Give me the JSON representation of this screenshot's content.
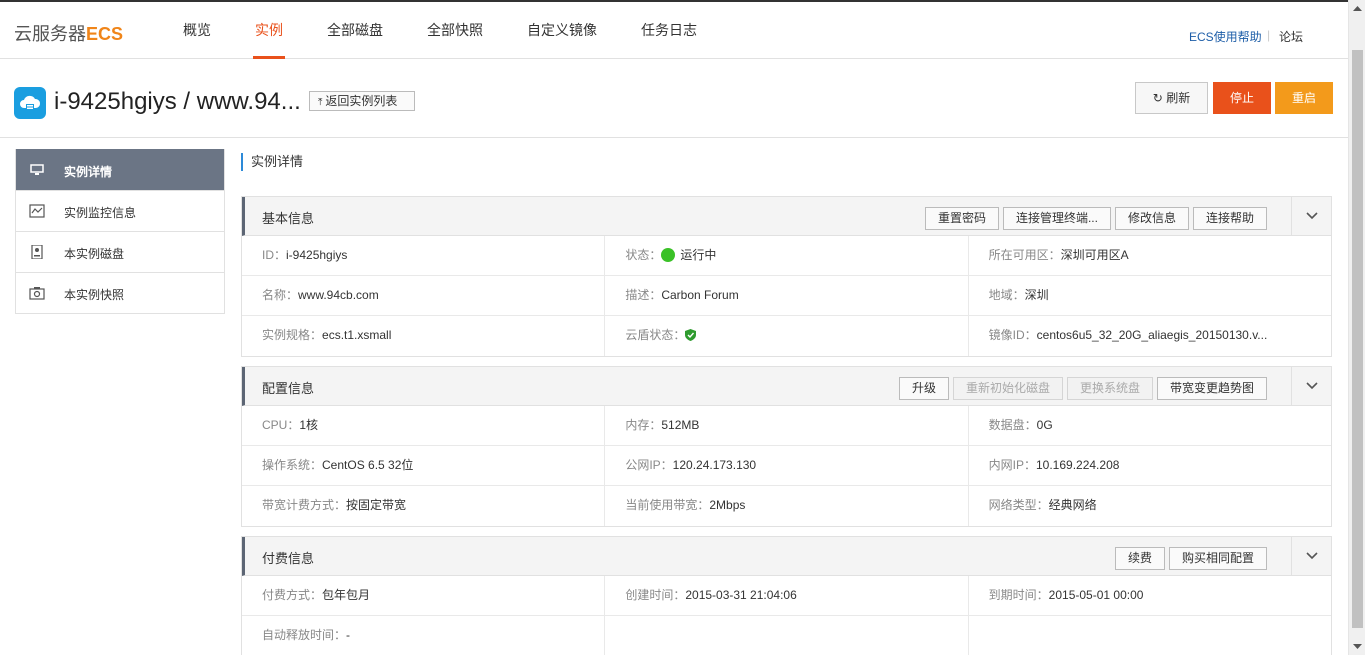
{
  "brand": {
    "prefix": "云服务器",
    "suffix": "ECS"
  },
  "nav": {
    "items": [
      "概览",
      "实例",
      "全部磁盘",
      "全部快照",
      "自定义镜像",
      "任务日志"
    ],
    "help": "ECS使用帮助",
    "separator": "|",
    "forum": "论坛"
  },
  "titlebar": {
    "title": "i-9425hgiys / www.94...",
    "back_label": "返回实例列表",
    "back_icon": "arrow-up-icon",
    "refresh_label": "刷新",
    "stop_label": "停止",
    "restart_label": "重启"
  },
  "sidebar": {
    "items": [
      {
        "label": "实例详情",
        "icon": "monitor-icon"
      },
      {
        "label": "实例监控信息",
        "icon": "chart-icon"
      },
      {
        "label": "本实例磁盘",
        "icon": "disk-icon"
      },
      {
        "label": "本实例快照",
        "icon": "camera-icon"
      }
    ]
  },
  "main": {
    "heading": "实例详情",
    "basic": {
      "title": "基本信息",
      "buttons": [
        "重置密码",
        "连接管理终端...",
        "修改信息",
        "连接帮助"
      ],
      "rows": [
        [
          {
            "k": "ID：",
            "v": "i-9425hgiys"
          },
          {
            "k": "状态：",
            "v": "运行中"
          },
          {
            "k": "所在可用区：",
            "v": "深圳可用区A"
          }
        ],
        [
          {
            "k": "名称：",
            "v": "www.94cb.com"
          },
          {
            "k": "描述：",
            "v": "Carbon Forum"
          },
          {
            "k": "地域：",
            "v": "深圳"
          }
        ],
        [
          {
            "k": "实例规格：",
            "v": "ecs.t1.xsmall"
          },
          {
            "k": "云盾状态：",
            "v": ""
          },
          {
            "k": "镜像ID：",
            "v": "centos6u5_32_20G_aliaegis_20150130.v..."
          }
        ]
      ]
    },
    "config": {
      "title": "配置信息",
      "buttons": [
        "升级",
        "重新初始化磁盘",
        "更换系统盘",
        "带宽变更趋势图"
      ],
      "rows": [
        [
          {
            "k": "CPU：",
            "v": "1核"
          },
          {
            "k": "内存：",
            "v": "512MB"
          },
          {
            "k": "数据盘：",
            "v": "0G"
          }
        ],
        [
          {
            "k": "操作系统：",
            "v": "CentOS 6.5 32位"
          },
          {
            "k": "公网IP：",
            "v": "120.24.173.130"
          },
          {
            "k": "内网IP：",
            "v": "10.169.224.208"
          }
        ],
        [
          {
            "k": "带宽计费方式：",
            "v": "按固定带宽"
          },
          {
            "k": "当前使用带宽：",
            "v": "2Mbps"
          },
          {
            "k": "网络类型：",
            "v": "经典网络"
          }
        ]
      ]
    },
    "billing": {
      "title": "付费信息",
      "buttons": [
        "续费",
        "购买相同配置"
      ],
      "rows": [
        [
          {
            "k": "付费方式：",
            "v": "包年包月"
          },
          {
            "k": "创建时间：",
            "v": "2015-03-31 21:04:06"
          },
          {
            "k": "到期时间：",
            "v": "2015-05-01 00:00"
          }
        ],
        [
          {
            "k": "自动释放时间：",
            "v": "-"
          },
          {
            "k": "",
            "v": ""
          },
          {
            "k": "",
            "v": ""
          }
        ]
      ]
    }
  },
  "colors": {
    "accent": "#e9511b",
    "restart": "#f39a1b",
    "brand": "#f08519",
    "link": "#1e5ea8",
    "running": "#3ac127",
    "sidebar_active": "#6b7585"
  }
}
